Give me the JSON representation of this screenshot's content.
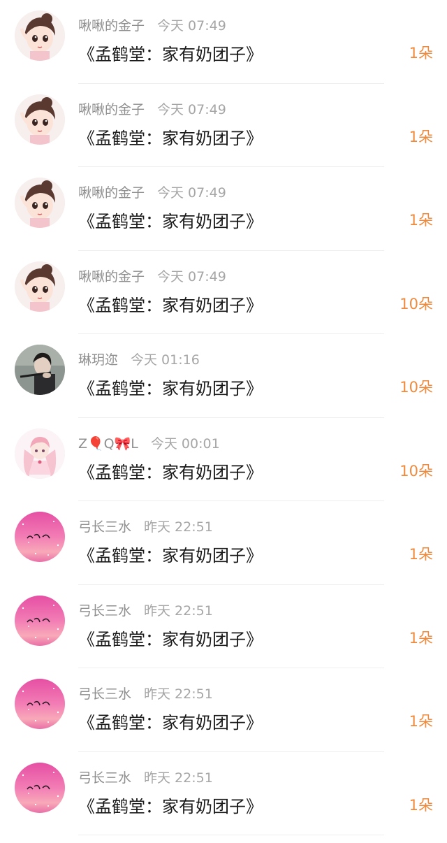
{
  "items": [
    {
      "avatar_icon": "girl-avatar-icon",
      "name": "啾啾的金子",
      "time": "今天 07:49",
      "title": "《孟鹤堂：家有奶团子》",
      "count": "1朵"
    },
    {
      "avatar_icon": "girl-avatar-icon",
      "name": "啾啾的金子",
      "time": "今天 07:49",
      "title": "《孟鹤堂：家有奶团子》",
      "count": "1朵"
    },
    {
      "avatar_icon": "girl-avatar-icon",
      "name": "啾啾的金子",
      "time": "今天 07:49",
      "title": "《孟鹤堂：家有奶团子》",
      "count": "1朵"
    },
    {
      "avatar_icon": "girl-avatar-icon",
      "name": "啾啾的金子",
      "time": "今天 07:49",
      "title": "《孟鹤堂：家有奶团子》",
      "count": "10朵"
    },
    {
      "avatar_icon": "man-flute-avatar-icon",
      "name": "琳玥迩",
      "time": "今天 01:16",
      "title": "《孟鹤堂：家有奶团子》",
      "count": "10朵"
    },
    {
      "avatar_icon": "anime-girl-avatar-icon",
      "name": "Z🎈Q🎀L",
      "time": "今天 00:01",
      "title": "《孟鹤堂：家有奶团子》",
      "count": "10朵"
    },
    {
      "avatar_icon": "pink-glitter-avatar-icon",
      "name": "弓长三水",
      "time": "昨天 22:51",
      "title": "《孟鹤堂：家有奶团子》",
      "count": "1朵"
    },
    {
      "avatar_icon": "pink-glitter-avatar-icon",
      "name": "弓长三水",
      "time": "昨天 22:51",
      "title": "《孟鹤堂：家有奶团子》",
      "count": "1朵"
    },
    {
      "avatar_icon": "pink-glitter-avatar-icon",
      "name": "弓长三水",
      "time": "昨天 22:51",
      "title": "《孟鹤堂：家有奶团子》",
      "count": "1朵"
    },
    {
      "avatar_icon": "pink-glitter-avatar-icon",
      "name": "弓长三水",
      "time": "昨天 22:51",
      "title": "《孟鹤堂：家有奶团子》",
      "count": "1朵"
    }
  ],
  "colors": {
    "count": "#ef8a3c",
    "name": "#8f8f8f",
    "title": "#1a1a1a"
  }
}
